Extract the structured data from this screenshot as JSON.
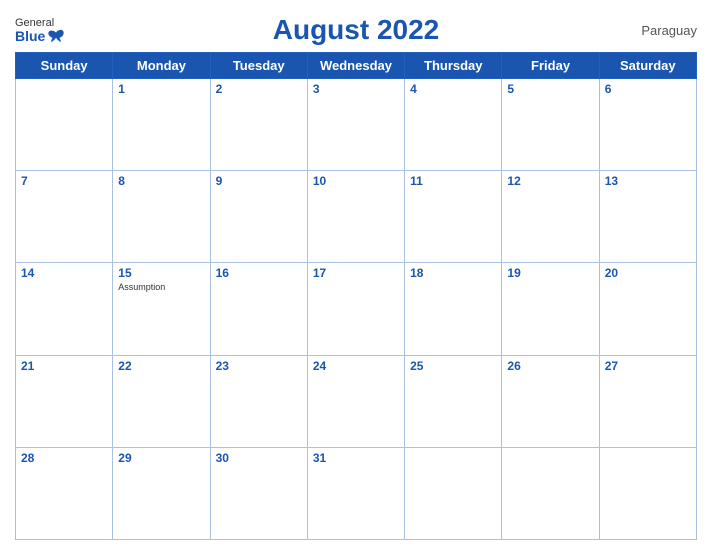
{
  "header": {
    "title": "August 2022",
    "country": "Paraguay",
    "logo": {
      "general": "General",
      "blue": "Blue"
    }
  },
  "weekdays": [
    "Sunday",
    "Monday",
    "Tuesday",
    "Wednesday",
    "Thursday",
    "Friday",
    "Saturday"
  ],
  "weeks": [
    [
      {
        "day": "",
        "empty": true
      },
      {
        "day": "1"
      },
      {
        "day": "2"
      },
      {
        "day": "3"
      },
      {
        "day": "4"
      },
      {
        "day": "5"
      },
      {
        "day": "6"
      }
    ],
    [
      {
        "day": "7"
      },
      {
        "day": "8"
      },
      {
        "day": "9"
      },
      {
        "day": "10"
      },
      {
        "day": "11"
      },
      {
        "day": "12"
      },
      {
        "day": "13"
      }
    ],
    [
      {
        "day": "14"
      },
      {
        "day": "15",
        "holiday": "Assumption"
      },
      {
        "day": "16"
      },
      {
        "day": "17"
      },
      {
        "day": "18"
      },
      {
        "day": "19"
      },
      {
        "day": "20"
      }
    ],
    [
      {
        "day": "21"
      },
      {
        "day": "22"
      },
      {
        "day": "23"
      },
      {
        "day": "24"
      },
      {
        "day": "25"
      },
      {
        "day": "26"
      },
      {
        "day": "27"
      }
    ],
    [
      {
        "day": "28"
      },
      {
        "day": "29"
      },
      {
        "day": "30"
      },
      {
        "day": "31"
      },
      {
        "day": "",
        "empty": true
      },
      {
        "day": "",
        "empty": true
      },
      {
        "day": "",
        "empty": true
      }
    ]
  ]
}
